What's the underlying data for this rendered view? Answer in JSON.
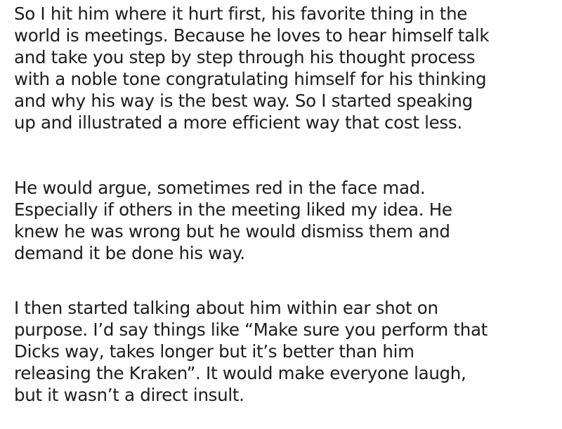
{
  "paragraphs": [
    {
      "lines": [
        "So I hit him where it hurt first, his favorite thing in the",
        "world is meetings. Because he loves to hear himself talk",
        "and take you step by step through his thought process",
        "with a noble tone congratulating himself for his thinking",
        "and why his way is the best way.  So I started speaking",
        "up and illustrated a more efficient way that cost less."
      ]
    },
    {
      "lines": [
        "He would argue, sometimes red in the face mad.",
        "Especially if others in the meeting liked my idea. He",
        "knew he was wrong but he would dismiss them and",
        "demand it be done his way."
      ]
    },
    {
      "lines": [
        "I then started talking about him within ear shot on",
        "purpose. I’d say things like “Make sure you perform that",
        "Dicks way, takes longer but it’s better than him",
        "releasing the Kraken”. It would make everyone laugh,",
        "but it wasn’t a direct insult."
      ]
    }
  ]
}
